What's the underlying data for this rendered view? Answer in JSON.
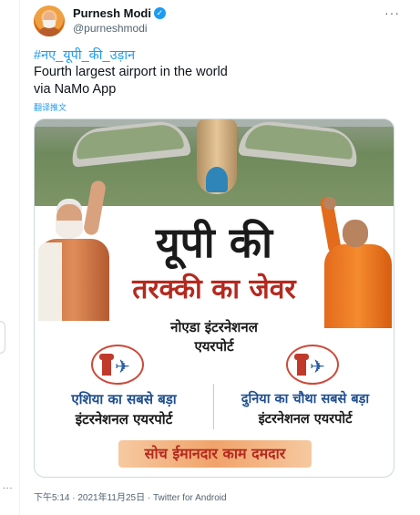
{
  "rail": {
    "dots": "..."
  },
  "author": {
    "display_name": "Purnesh Modi",
    "handle": "@purneshmodi",
    "verified_symbol": "✓"
  },
  "more_menu": "···",
  "tweet": {
    "hashtag": "#नए_यूपी_की_उड़ान",
    "text_line1": "Fourth largest airport in the world",
    "text_line2": "via NaMo App",
    "translate_label": "翻译推文"
  },
  "media": {
    "headline_line1": "यूपी की",
    "headline_line2": "तरक्की का जेवर",
    "subhead_line1": "नोएडा इंटरनेशनल",
    "subhead_line2": "एयरपोर्ट",
    "feature_left_line1": "एशिया का सबसे बड़ा",
    "feature_left_line2": "इंटरनेशनल एयरपोर्ट",
    "feature_right_line1": "दुनिया का चौथा सबसे बड़ा",
    "feature_right_line2": "इंटरनेशनल एयरपोर्ट",
    "slogan": "सोच ईमानदार काम दमदार",
    "plane_glyph": "✈"
  },
  "meta": {
    "text": "下午5:14 · 2021年11月25日 · Twitter for Android"
  },
  "colors": {
    "accent": "#1d9bf0",
    "headline_red": "#b4291e",
    "feature_blue": "#1f4e8f"
  }
}
